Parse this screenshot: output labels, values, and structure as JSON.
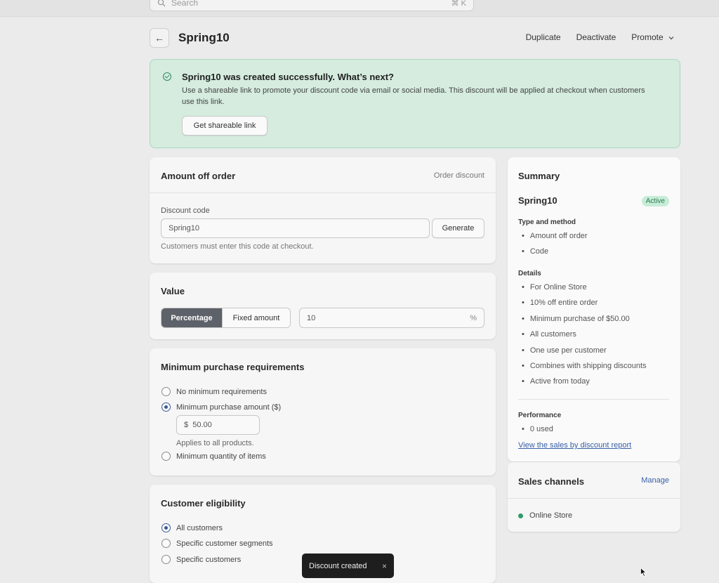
{
  "search": {
    "placeholder": "Search",
    "shortcut": "⌘ K"
  },
  "header": {
    "title": "Spring10",
    "actions": {
      "duplicate": "Duplicate",
      "deactivate": "Deactivate",
      "promote": "Promote"
    }
  },
  "banner": {
    "title": "Spring10 was created successfully. What’s next?",
    "description": "Use a shareable link to promote your discount code via email or social media. This discount will be applied at checkout when customers use this link.",
    "button": "Get shareable link"
  },
  "amount_card": {
    "title": "Amount off order",
    "type_hint": "Order discount",
    "code_label": "Discount code",
    "code_value": "Spring10",
    "generate_button": "Generate",
    "help": "Customers must enter this code at checkout."
  },
  "value_card": {
    "title": "Value",
    "options": {
      "percentage": "Percentage",
      "fixed": "Fixed amount"
    },
    "value": "10",
    "suffix": "%"
  },
  "minimum_card": {
    "title": "Minimum purchase requirements",
    "options": {
      "none": "No minimum requirements",
      "amount": "Minimum purchase amount ($)",
      "quantity": "Minimum quantity of items"
    },
    "amount_value": "$  50.00",
    "applies": "Applies to all products."
  },
  "eligibility_card": {
    "title": "Customer eligibility",
    "options": {
      "all": "All customers",
      "segments": "Specific customer segments",
      "specific": "Specific customers"
    }
  },
  "summary": {
    "title": "Summary",
    "code": "Spring10",
    "status": "Active",
    "type_label": "Type and method",
    "type_items": [
      "Amount off order",
      "Code"
    ],
    "details_label": "Details",
    "details_items": [
      "For Online Store",
      "10% off entire order",
      "Minimum purchase of $50.00",
      "All customers",
      "One use per customer",
      "Combines with shipping discounts",
      "Active from today"
    ],
    "performance_label": "Performance",
    "performance_items": [
      "0 used"
    ],
    "report_link": "View the sales by discount report"
  },
  "channels": {
    "title": "Sales channels",
    "manage": "Manage",
    "channel": "Online Store"
  },
  "toast": {
    "text": "Discount created",
    "close": "×"
  },
  "colors": {
    "banner_bg": "#d5ecdf",
    "accent": "#3860a8",
    "active_badge": "#c7ecd8",
    "channel_dot": "#2f9a6a"
  }
}
